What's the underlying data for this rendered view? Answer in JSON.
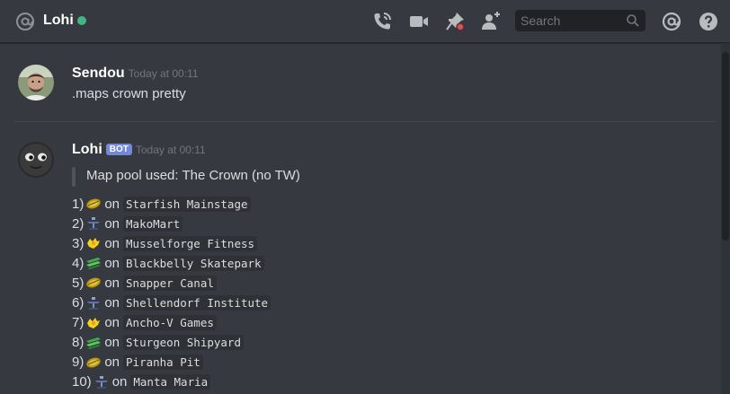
{
  "header": {
    "channel_name": "Lohi",
    "status_color": "#43b581",
    "search_placeholder": "Search",
    "icons": [
      "at-sign-icon",
      "call-icon",
      "video-icon",
      "pin-icon",
      "add-user-icon",
      "search-icon",
      "mention-icon",
      "help-icon"
    ]
  },
  "messages": [
    {
      "author": "Sendou",
      "timestamp": "Today at 00:11",
      "text": ".maps crown pretty"
    },
    {
      "author": "Lohi",
      "bot_tag": "BOT",
      "timestamp": "Today at 00:11",
      "quote": "Map pool used: The Crown (no TW)",
      "rows": [
        {
          "num": "1)",
          "mode": "rainmaker-icon",
          "on": "on",
          "map": "Starfish Mainstage"
        },
        {
          "num": "2)",
          "mode": "tower-control-icon",
          "on": "on",
          "map": "MakoMart"
        },
        {
          "num": "3)",
          "mode": "clam-blitz-icon",
          "on": "on",
          "map": "Musselforge Fitness"
        },
        {
          "num": "4)",
          "mode": "splat-zones-icon",
          "on": "on",
          "map": "Blackbelly Skatepark"
        },
        {
          "num": "5)",
          "mode": "rainmaker-icon",
          "on": "on",
          "map": "Snapper Canal"
        },
        {
          "num": "6)",
          "mode": "tower-control-icon",
          "on": "on",
          "map": "Shellendorf Institute"
        },
        {
          "num": "7)",
          "mode": "clam-blitz-icon",
          "on": "on",
          "map": "Ancho-V Games"
        },
        {
          "num": "8)",
          "mode": "splat-zones-icon",
          "on": "on",
          "map": "Sturgeon Shipyard"
        },
        {
          "num": "9)",
          "mode": "rainmaker-icon",
          "on": "on",
          "map": "Piranha Pit"
        },
        {
          "num": "10)",
          "mode": "tower-control-icon",
          "on": "on",
          "map": "Manta Maria"
        }
      ]
    }
  ]
}
